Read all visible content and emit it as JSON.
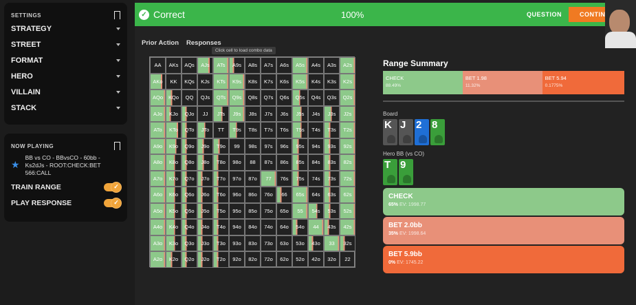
{
  "settings": {
    "title": "SETTINGS",
    "items": [
      "STRATEGY",
      "STREET",
      "FORMAT",
      "HERO",
      "VILLAIN",
      "STACK"
    ]
  },
  "now_playing": {
    "title": "NOW PLAYING",
    "description": "BB vs CO - BBvsCO - 60bb - Ks2dJs - ROOT:CHECK:BET 566:CALL",
    "toggles": [
      {
        "label": "TRAIN RANGE",
        "on": true
      },
      {
        "label": "PLAY RESPONSE",
        "on": true
      }
    ]
  },
  "banner": {
    "status": "Correct",
    "percent": "100%",
    "question_label": "QUESTION",
    "continue_label": "CONTIN",
    "color": "#3bb54a"
  },
  "tabs": [
    "Prior Action",
    "Responses"
  ],
  "tooltip": "Click cell to load combo data",
  "grid": {
    "rows": [
      [
        "AA",
        "AKs",
        "AQs",
        "AJs",
        "ATs",
        "A9s",
        "A8s",
        "A7s",
        "A6s",
        "A5s",
        "A4s",
        "A3s",
        "A2s"
      ],
      [
        "AKo",
        "KK",
        "KQs",
        "KJs",
        "KTs",
        "K9s",
        "K8s",
        "K7s",
        "K6s",
        "K5s",
        "K4s",
        "K3s",
        "K2s"
      ],
      [
        "AQo",
        "KQo",
        "QQ",
        "QJs",
        "QTs",
        "Q9s",
        "Q8s",
        "Q7s",
        "Q6s",
        "Q5s",
        "Q4s",
        "Q3s",
        "Q2s"
      ],
      [
        "AJo",
        "KJo",
        "QJo",
        "JJ",
        "JTs",
        "J9s",
        "J8s",
        "J7s",
        "J6s",
        "J5s",
        "J4s",
        "J3s",
        "J2s"
      ],
      [
        "ATo",
        "KTo",
        "QTo",
        "JTo",
        "TT",
        "T9s",
        "T8s",
        "T7s",
        "T6s",
        "T5s",
        "T4s",
        "T3s",
        "T2s"
      ],
      [
        "A9o",
        "K9o",
        "Q9o",
        "J9o",
        "T9o",
        "99",
        "98s",
        "97s",
        "96s",
        "95s",
        "94s",
        "93s",
        "92s"
      ],
      [
        "A8o",
        "K8o",
        "Q8o",
        "J8o",
        "T8o",
        "98o",
        "88",
        "87s",
        "86s",
        "85s",
        "84s",
        "83s",
        "82s"
      ],
      [
        "A7o",
        "K7o",
        "Q7o",
        "J7o",
        "T7o",
        "97o",
        "87o",
        "77",
        "76s",
        "75s",
        "74s",
        "73s",
        "72s"
      ],
      [
        "A6o",
        "K6o",
        "Q6o",
        "J6o",
        "T6o",
        "96o",
        "86o",
        "76o",
        "66",
        "65s",
        "64s",
        "63s",
        "62s"
      ],
      [
        "A5o",
        "K5o",
        "Q5o",
        "J5o",
        "T5o",
        "95o",
        "85o",
        "75o",
        "65o",
        "55",
        "54s",
        "53s",
        "52s"
      ],
      [
        "A4o",
        "K4o",
        "Q4o",
        "J4o",
        "T4o",
        "94o",
        "84o",
        "74o",
        "64o",
        "54o",
        "44",
        "43s",
        "42s"
      ],
      [
        "A3o",
        "K3o",
        "Q3o",
        "J3o",
        "T3o",
        "93o",
        "83o",
        "73o",
        "63o",
        "53o",
        "43o",
        "33",
        "32s"
      ],
      [
        "A2o",
        "K2o",
        "Q2o",
        "J2o",
        "T2o",
        "92o",
        "82o",
        "72o",
        "62o",
        "52o",
        "42o",
        "32o",
        "22"
      ]
    ],
    "highlight": [
      [
        0,
        0,
        0,
        0.8,
        1,
        0.3,
        0,
        0,
        0,
        1,
        0,
        0,
        1
      ],
      [
        0.8,
        0,
        0,
        0,
        1,
        1,
        0,
        0,
        0,
        1,
        0,
        0,
        1
      ],
      [
        1,
        0.4,
        0,
        0,
        1,
        1,
        0,
        0,
        0,
        0.5,
        0,
        0,
        1
      ],
      [
        1,
        0.3,
        0.3,
        0,
        0.6,
        1,
        0,
        0,
        0,
        0.6,
        0,
        0.5,
        1
      ],
      [
        1,
        0.8,
        0.3,
        0.5,
        0,
        0.5,
        0,
        0,
        0,
        0.6,
        0,
        0.4,
        1
      ],
      [
        1,
        0.7,
        0.3,
        0.4,
        0.4,
        0,
        0,
        0,
        0,
        0.4,
        0,
        0.4,
        1
      ],
      [
        1,
        0.6,
        0.3,
        0.4,
        0.3,
        0,
        0,
        0,
        0,
        0.4,
        0,
        0.4,
        1
      ],
      [
        1,
        0.6,
        0.3,
        0.3,
        0.3,
        0,
        0,
        1,
        0,
        0.4,
        0,
        0.4,
        1
      ],
      [
        1,
        0.6,
        0.3,
        0.3,
        0.3,
        0,
        0,
        0,
        0.3,
        1,
        0,
        0.4,
        1
      ],
      [
        1,
        0.6,
        0.3,
        0.3,
        0.3,
        0,
        0,
        0,
        0,
        1,
        0.6,
        0.4,
        1
      ],
      [
        1,
        0.6,
        0.3,
        0.3,
        0.3,
        0,
        0,
        0,
        0,
        0.3,
        1,
        0.3,
        1
      ],
      [
        1,
        0.6,
        0.3,
        0.3,
        0.3,
        0,
        0,
        0,
        0,
        0,
        0.3,
        1,
        0.3
      ],
      [
        1,
        0.4,
        0.3,
        0.3,
        0.3,
        0,
        0,
        0,
        0,
        0,
        0,
        0,
        0
      ]
    ]
  },
  "range_summary": {
    "title": "Range Summary",
    "segments": [
      {
        "label": "CHECK",
        "pct": "88.49%",
        "share": 0.33,
        "color": "#8dc98a"
      },
      {
        "label": "BET 1.98",
        "pct": "11.32%",
        "share": 0.33,
        "color": "#e89078"
      },
      {
        "label": "BET 5.94",
        "pct": "0.1775%",
        "share": 0.34,
        "color": "#f06a3a"
      }
    ]
  },
  "board": {
    "label": "Board",
    "cards": [
      {
        "rank": "K",
        "color": "#555555"
      },
      {
        "rank": "J",
        "color": "#555555"
      },
      {
        "rank": "2",
        "color": "#1f6fd6"
      },
      {
        "rank": "8",
        "color": "#3a9e3a"
      }
    ]
  },
  "hero": {
    "label": "Hero BB (vs CO)",
    "cards": [
      {
        "rank": "T",
        "color": "#3a9e3a"
      },
      {
        "rank": "9",
        "color": "#3a9e3a"
      }
    ]
  },
  "actions": [
    {
      "name": "CHECK",
      "freq": "65%",
      "ev": "EV: 1998.77",
      "color": "#8dc98a"
    },
    {
      "name": "BET 2.0bb",
      "freq": "35%",
      "ev": "EV: 1998.64",
      "color": "#e89078"
    },
    {
      "name": "BET 5.9bb",
      "freq": "0%",
      "ev": "EV: 1745.22",
      "color": "#f06a3a"
    }
  ],
  "colors": {
    "check": "#8dc98a",
    "bet_small": "#e89078",
    "bet_big": "#f06a3a",
    "accent": "#f0a43a"
  }
}
